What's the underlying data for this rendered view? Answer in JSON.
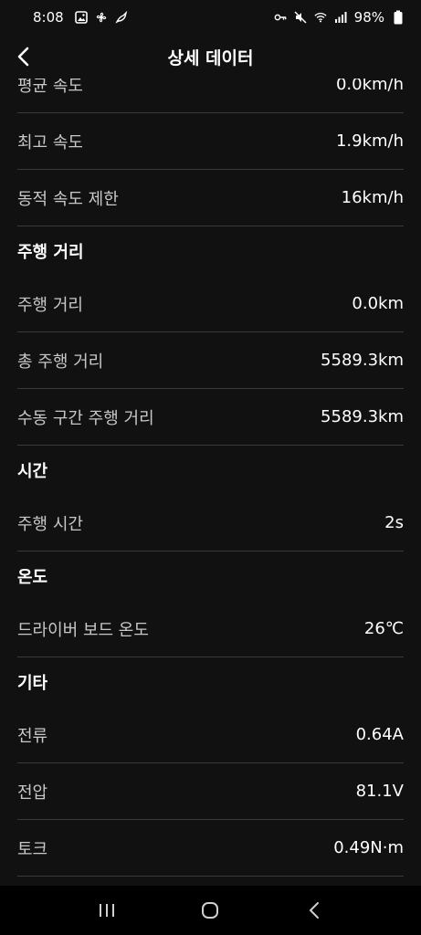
{
  "status_bar": {
    "time": "8:08",
    "battery": "98%",
    "left_icons": [
      "image-icon",
      "fan-icon",
      "bird-icon"
    ],
    "right_icons": [
      "key-icon",
      "mute-icon",
      "wifi-icon",
      "signal-icon",
      "battery-icon"
    ]
  },
  "header": {
    "title": "상세 데이터",
    "back_icon": "chevron-left-icon"
  },
  "rows_top": [
    {
      "label": "평균 속도",
      "value": "0.0km/h"
    },
    {
      "label": "최고 속도",
      "value": "1.9km/h"
    },
    {
      "label": "동적 속도 제한",
      "value": "16km/h"
    }
  ],
  "sections": [
    {
      "title": "주행 거리",
      "rows": [
        {
          "label": "주행 거리",
          "value": "0.0km"
        },
        {
          "label": "총 주행 거리",
          "value": "5589.3km"
        },
        {
          "label": "수동 구간 주행 거리",
          "value": "5589.3km"
        }
      ]
    },
    {
      "title": "시간",
      "rows": [
        {
          "label": "주행 시간",
          "value": "2s"
        }
      ]
    },
    {
      "title": "온도",
      "rows": [
        {
          "label": "드라이버 보드 온도",
          "value": "26℃"
        }
      ]
    },
    {
      "title": "기타",
      "rows": [
        {
          "label": "전류",
          "value": "0.64A"
        },
        {
          "label": "전압",
          "value": "81.1V"
        },
        {
          "label": "토크",
          "value": "0.49N·m"
        }
      ]
    }
  ],
  "nav_bar": {
    "icons": [
      "recent-apps-icon",
      "home-icon",
      "back-icon"
    ]
  }
}
